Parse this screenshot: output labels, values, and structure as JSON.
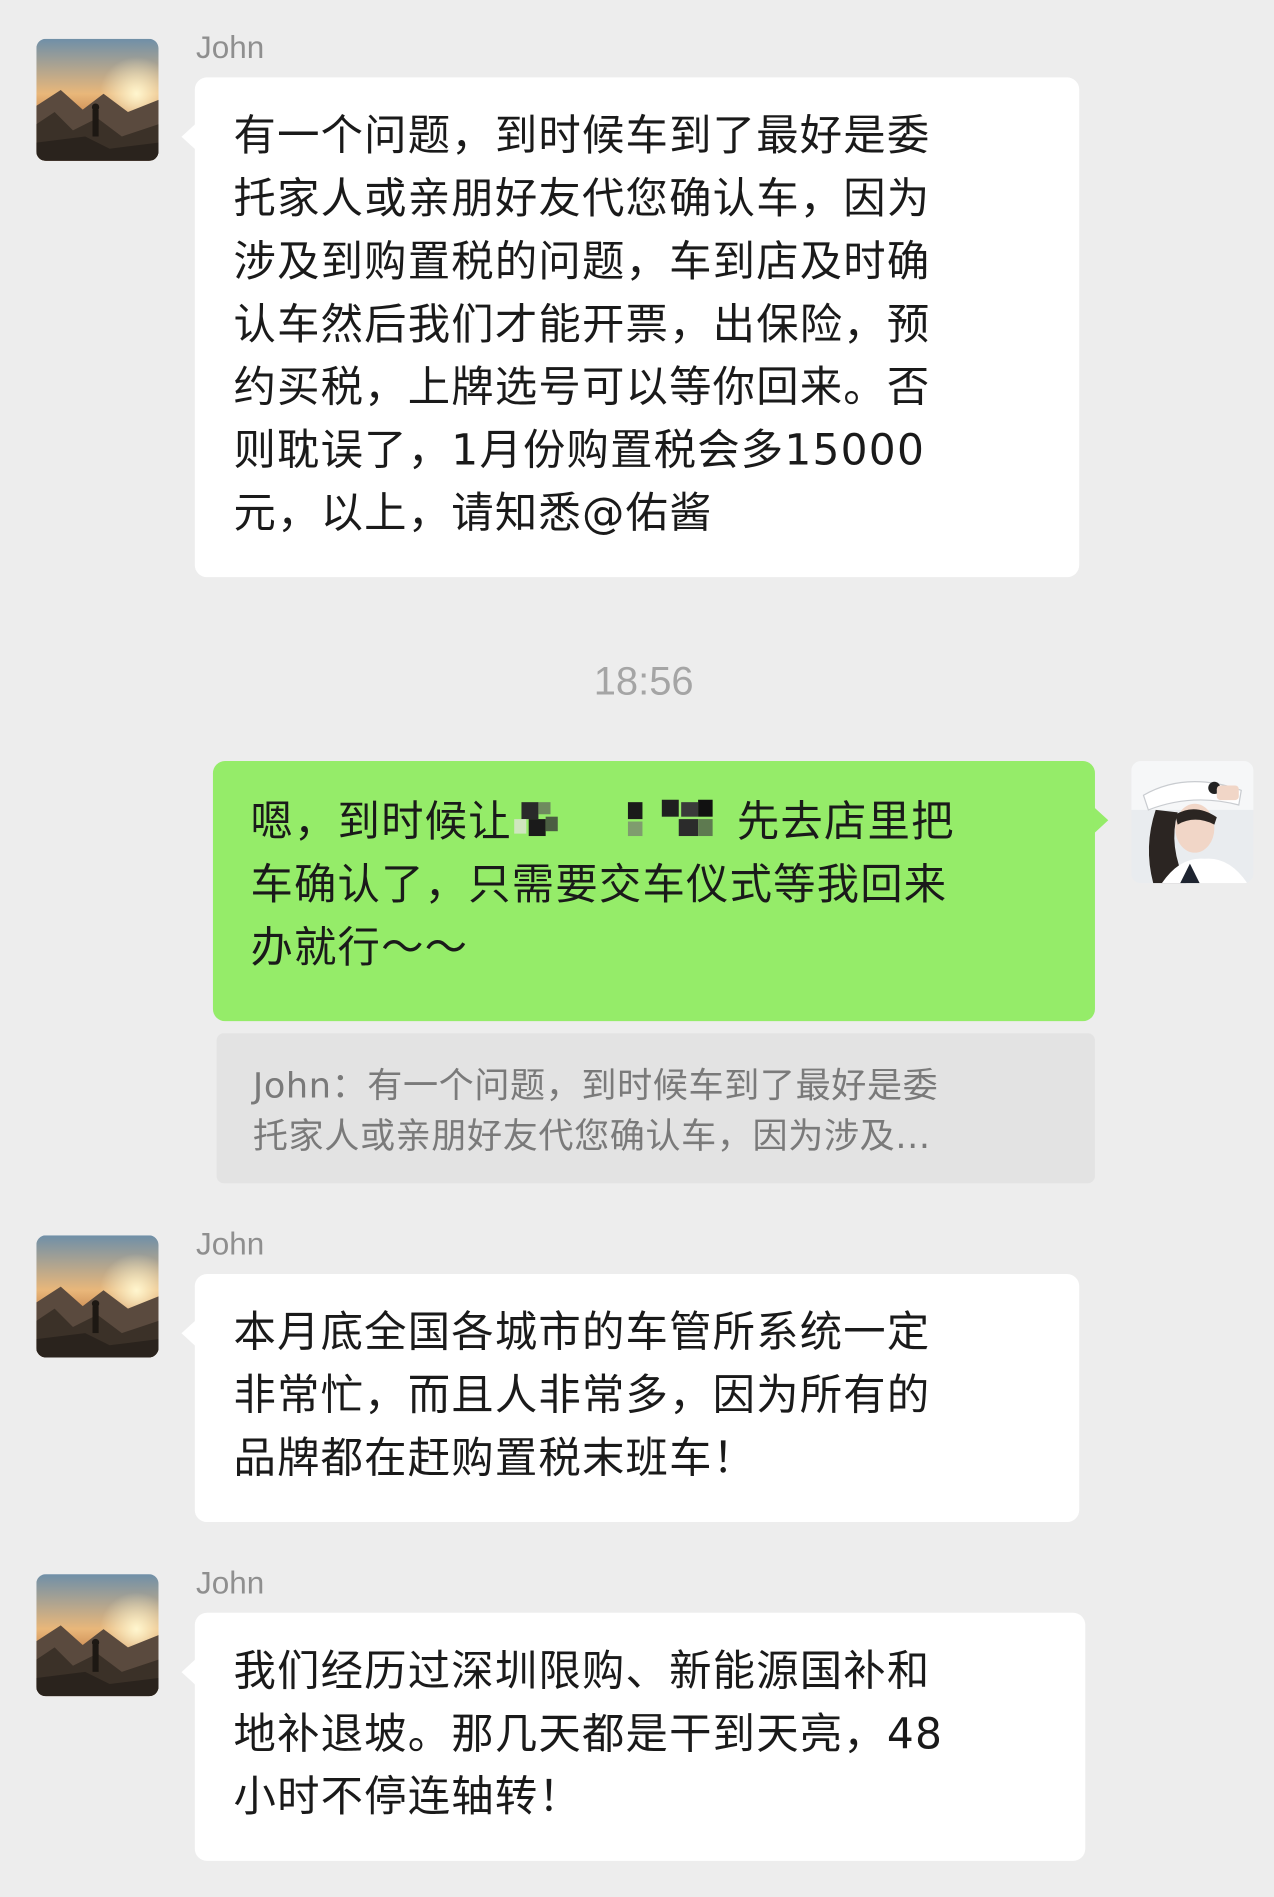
{
  "conversation": {
    "timestamp": "18:56",
    "messages": [
      {
        "direction": "incoming",
        "sender": "John",
        "avatar": "mountain-sunset-avatar",
        "lines": [
          "有一个问题，到时候车到了最好是委",
          "托家人或亲朋好友代您确认车，因为",
          "涉及到购置税的问题，车到店及时确",
          "认车然后我们才能开票，出保险，预",
          "约买税，上牌选号可以等你回来。否",
          "则耽误了，1月份购置税会多15000",
          "元，以上，请知悉@佑酱"
        ]
      },
      {
        "direction": "outgoing",
        "avatar": "woman-white-cap-avatar",
        "line1_before": "嗯，到时候让",
        "line1_after": "先去店里把",
        "lines_rest": [
          "车确认了，只需要交车仪式等我回来",
          "办就行～～"
        ],
        "quote": {
          "lines": [
            "John：有一个问题，到时候车到了最好是委",
            "托家人或亲朋好友代您确认车，因为涉及..."
          ]
        }
      },
      {
        "direction": "incoming",
        "sender": "John",
        "avatar": "mountain-sunset-avatar",
        "lines": [
          "本月底全国各城市的车管所系统一定",
          "非常忙，而且人非常多，因为所有的",
          "品牌都在赶购置税末班车！"
        ]
      },
      {
        "direction": "incoming",
        "sender": "John",
        "avatar": "mountain-sunset-avatar",
        "lines": [
          "我们经历过深圳限购、新能源国补和",
          "地补退坡。那几天都是干到天亮，48",
          "小时不停连轴转！"
        ]
      }
    ]
  },
  "colors": {
    "background": "#ededed",
    "incoming_bubble": "#ffffff",
    "outgoing_bubble": "#95ec69",
    "quote_background": "#e3e3e3",
    "timestamp_text": "#a5a5a5",
    "sender_text": "#8f8f8f"
  }
}
